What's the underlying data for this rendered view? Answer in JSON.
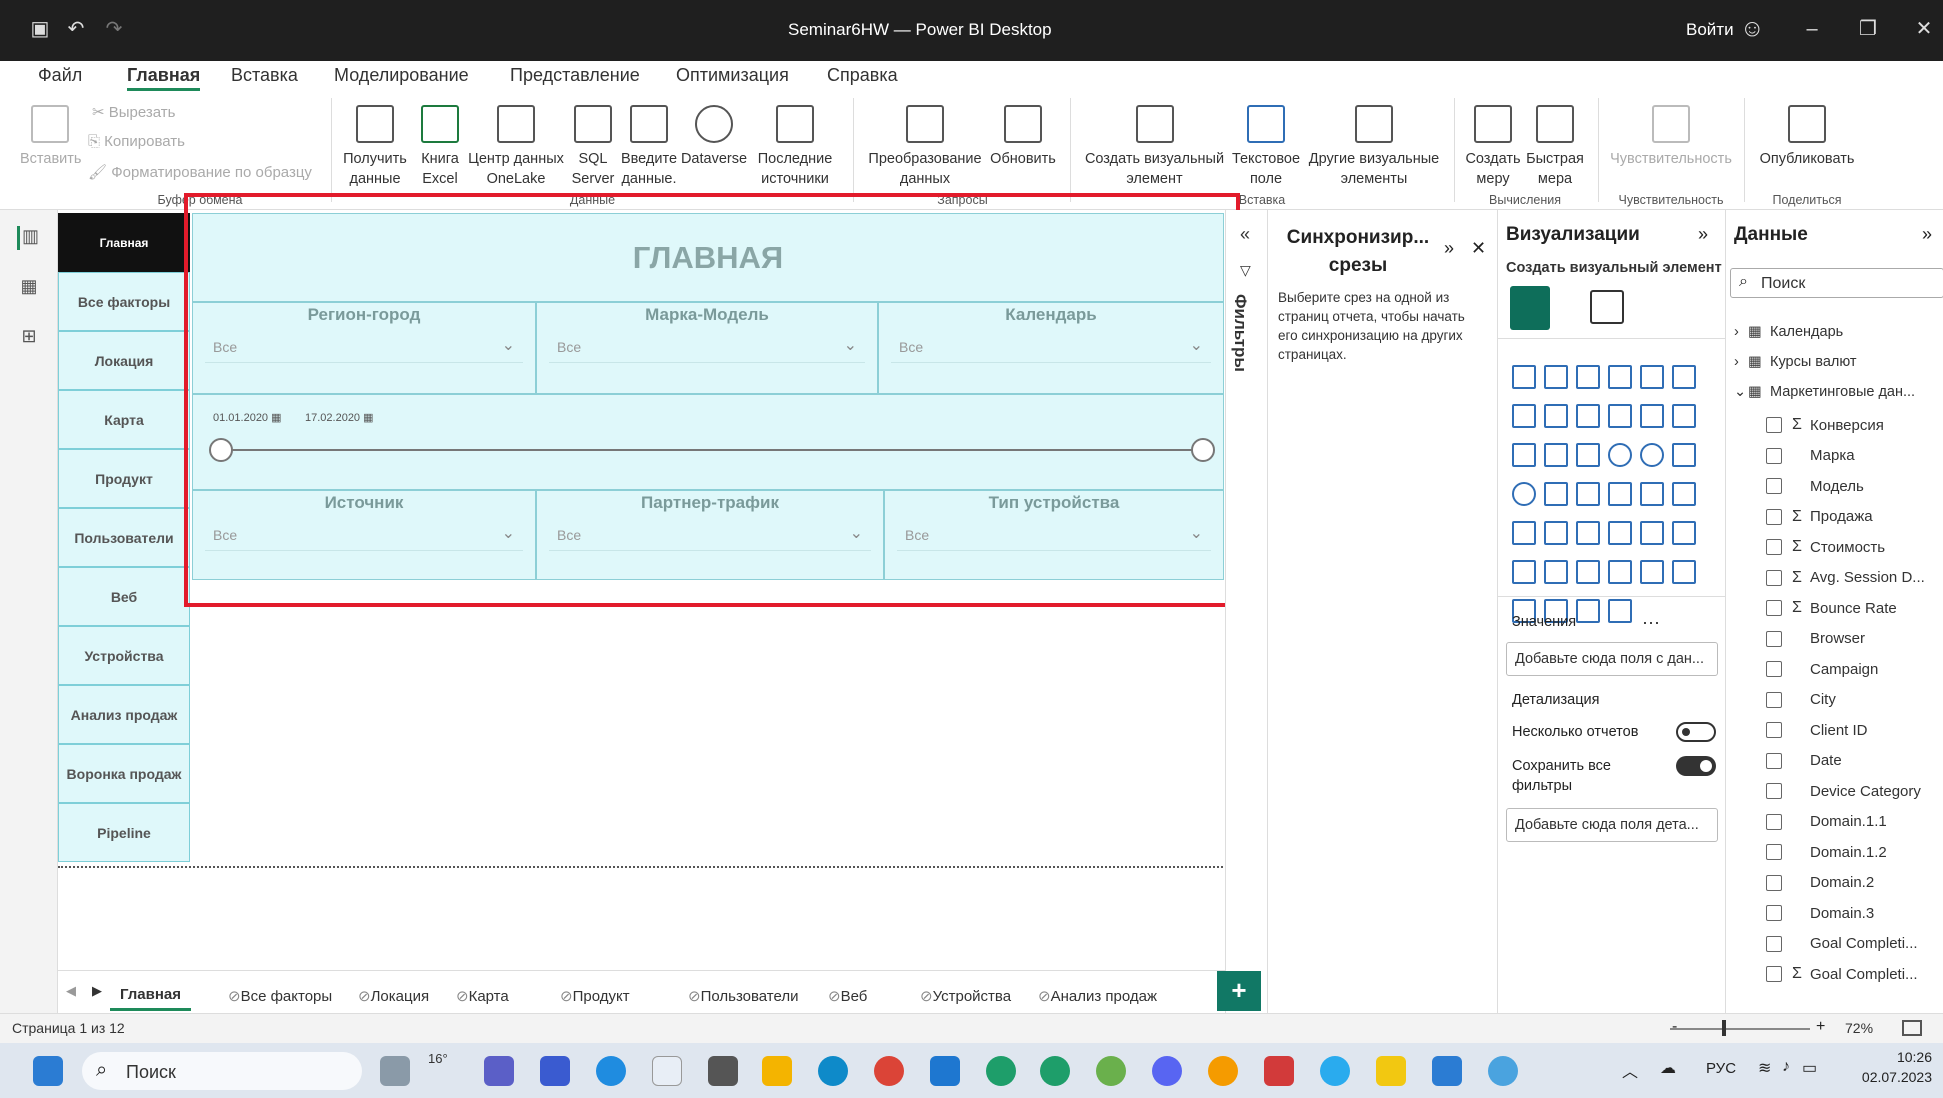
{
  "window": {
    "title": "Seminar6HW — Power BI Desktop",
    "signin": "Войти"
  },
  "menu": [
    "Файл",
    "Главная",
    "Вставка",
    "Моделирование",
    "Представление",
    "Оптимизация",
    "Справка"
  ],
  "ribbon": {
    "clipboard": {
      "paste": "Вставить",
      "cut": "Вырезать",
      "copy": "Копировать",
      "format": "Форматирование по образцу",
      "group": "Буфер обмена"
    },
    "data": {
      "get": "Получить данные",
      "excel": "Книга Excel",
      "onelake": "Центр данных OneLake",
      "sql": "SQL Server",
      "enter": "Введите данные.",
      "dataverse": "Dataverse",
      "recent": "Последние источники",
      "group": "Данные"
    },
    "queries": {
      "transform": "Преобразование данных",
      "refresh": "Обновить",
      "group": "Запросы"
    },
    "insert": {
      "visual": "Создать визуальный элемент",
      "text": "Текстовое поле",
      "more": "Другие визуальные элементы",
      "group": "Вставка"
    },
    "calc": {
      "measure": "Создать меру",
      "quick": "Быстрая мера",
      "group": "Вычисления"
    },
    "sens": {
      "label": "Чувствительность",
      "group": "Чувствительность"
    },
    "share": {
      "publish": "Опубликовать",
      "group": "Поделиться"
    }
  },
  "pages_nav": [
    "Главная",
    "Все факторы",
    "Локация",
    "Карта",
    "Продукт",
    "Пользователи",
    "Веб",
    "Устройства",
    "Анализ продаж",
    "Воронка продаж",
    "Pipeline"
  ],
  "report": {
    "heading": "ГЛАВНАЯ",
    "slicers_row1": [
      {
        "title": "Регион-город",
        "value": "Все"
      },
      {
        "title": "Марка-Модель",
        "value": "Все"
      },
      {
        "title": "Календарь",
        "value": "Все"
      }
    ],
    "date_from": "01.01.2020",
    "date_to": "17.02.2020",
    "slicers_row2": [
      {
        "title": "Источник",
        "value": "Все"
      },
      {
        "title": "Партнер-трафик",
        "value": "Все"
      },
      {
        "title": "Тип устройства",
        "value": "Все"
      }
    ]
  },
  "filters_label": "Фильтры",
  "sync": {
    "title": "Синхронизир... срезы",
    "text": "Выберите срез на одной из страниц отчета, чтобы начать его синхронизацию на других страницах."
  },
  "viz": {
    "title": "Визуализации",
    "create": "Создать визуальный элемент",
    "values": "Значения",
    "values_drop": "Добавьте сюда поля с дан...",
    "drill": "Детализация",
    "multi": "Несколько отчетов",
    "keep": "Сохранить все фильтры",
    "drill_drop": "Добавьте сюда поля дета...",
    "multi_on": false,
    "keep_on": true
  },
  "data_pane": {
    "title": "Данные",
    "search_placeholder": "Поиск",
    "tables": [
      "Календарь",
      "Курсы валют",
      "Маркетинговые дан..."
    ],
    "fields": [
      {
        "name": "Конверсия",
        "sigma": true
      },
      {
        "name": "Марка",
        "sigma": false
      },
      {
        "name": "Модель",
        "sigma": false
      },
      {
        "name": "Продажа",
        "sigma": true
      },
      {
        "name": "Стоимость",
        "sigma": true
      },
      {
        "name": "Avg. Session D...",
        "sigma": true
      },
      {
        "name": "Bounce Rate",
        "sigma": true
      },
      {
        "name": "Browser",
        "sigma": false
      },
      {
        "name": "Campaign",
        "sigma": false
      },
      {
        "name": "City",
        "sigma": false
      },
      {
        "name": "Client ID",
        "sigma": false
      },
      {
        "name": "Date",
        "sigma": false
      },
      {
        "name": "Device Category",
        "sigma": false
      },
      {
        "name": "Domain.1.1",
        "sigma": false
      },
      {
        "name": "Domain.1.2",
        "sigma": false
      },
      {
        "name": "Domain.2",
        "sigma": false
      },
      {
        "name": "Domain.3",
        "sigma": false
      },
      {
        "name": "Goal Completi...",
        "sigma": false
      },
      {
        "name": "Goal Completi...",
        "sigma": true
      }
    ]
  },
  "tabs": [
    "Главная",
    "Все факторы",
    "Локация",
    "Карта",
    "Продукт",
    "Пользователи",
    "Веб",
    "Устройства",
    "Анализ продаж"
  ],
  "status": {
    "page": "Страница 1 из 12",
    "zoom": "72%"
  },
  "taskbar": {
    "search": "Поиск",
    "weather": "16°",
    "lang": "РУС",
    "time": "10:26",
    "date": "02.07.2023"
  },
  "colors": {
    "accent": "#1e8a5a",
    "slicer_bg": "#dff8fa",
    "highlight": "#e21b2b"
  }
}
